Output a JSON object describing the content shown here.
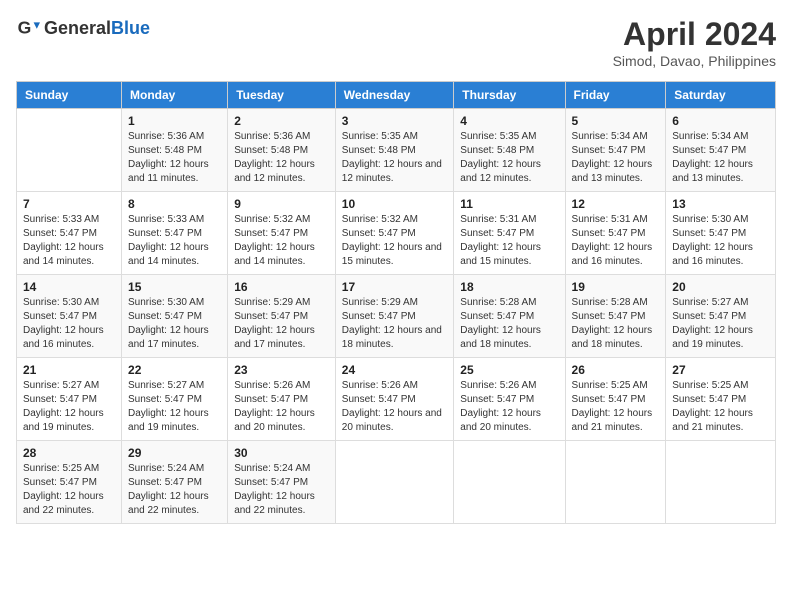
{
  "logo": {
    "text_general": "General",
    "text_blue": "Blue"
  },
  "title": "April 2024",
  "subtitle": "Simod, Davao, Philippines",
  "days_header": [
    "Sunday",
    "Monday",
    "Tuesday",
    "Wednesday",
    "Thursday",
    "Friday",
    "Saturday"
  ],
  "weeks": [
    [
      {
        "num": "",
        "info": ""
      },
      {
        "num": "1",
        "info": "Sunrise: 5:36 AM\nSunset: 5:48 PM\nDaylight: 12 hours and 11 minutes."
      },
      {
        "num": "2",
        "info": "Sunrise: 5:36 AM\nSunset: 5:48 PM\nDaylight: 12 hours and 12 minutes."
      },
      {
        "num": "3",
        "info": "Sunrise: 5:35 AM\nSunset: 5:48 PM\nDaylight: 12 hours and 12 minutes."
      },
      {
        "num": "4",
        "info": "Sunrise: 5:35 AM\nSunset: 5:48 PM\nDaylight: 12 hours and 12 minutes."
      },
      {
        "num": "5",
        "info": "Sunrise: 5:34 AM\nSunset: 5:47 PM\nDaylight: 12 hours and 13 minutes."
      },
      {
        "num": "6",
        "info": "Sunrise: 5:34 AM\nSunset: 5:47 PM\nDaylight: 12 hours and 13 minutes."
      }
    ],
    [
      {
        "num": "7",
        "info": "Sunrise: 5:33 AM\nSunset: 5:47 PM\nDaylight: 12 hours and 14 minutes."
      },
      {
        "num": "8",
        "info": "Sunrise: 5:33 AM\nSunset: 5:47 PM\nDaylight: 12 hours and 14 minutes."
      },
      {
        "num": "9",
        "info": "Sunrise: 5:32 AM\nSunset: 5:47 PM\nDaylight: 12 hours and 14 minutes."
      },
      {
        "num": "10",
        "info": "Sunrise: 5:32 AM\nSunset: 5:47 PM\nDaylight: 12 hours and 15 minutes."
      },
      {
        "num": "11",
        "info": "Sunrise: 5:31 AM\nSunset: 5:47 PM\nDaylight: 12 hours and 15 minutes."
      },
      {
        "num": "12",
        "info": "Sunrise: 5:31 AM\nSunset: 5:47 PM\nDaylight: 12 hours and 16 minutes."
      },
      {
        "num": "13",
        "info": "Sunrise: 5:30 AM\nSunset: 5:47 PM\nDaylight: 12 hours and 16 minutes."
      }
    ],
    [
      {
        "num": "14",
        "info": "Sunrise: 5:30 AM\nSunset: 5:47 PM\nDaylight: 12 hours and 16 minutes."
      },
      {
        "num": "15",
        "info": "Sunrise: 5:30 AM\nSunset: 5:47 PM\nDaylight: 12 hours and 17 minutes."
      },
      {
        "num": "16",
        "info": "Sunrise: 5:29 AM\nSunset: 5:47 PM\nDaylight: 12 hours and 17 minutes."
      },
      {
        "num": "17",
        "info": "Sunrise: 5:29 AM\nSunset: 5:47 PM\nDaylight: 12 hours and 18 minutes."
      },
      {
        "num": "18",
        "info": "Sunrise: 5:28 AM\nSunset: 5:47 PM\nDaylight: 12 hours and 18 minutes."
      },
      {
        "num": "19",
        "info": "Sunrise: 5:28 AM\nSunset: 5:47 PM\nDaylight: 12 hours and 18 minutes."
      },
      {
        "num": "20",
        "info": "Sunrise: 5:27 AM\nSunset: 5:47 PM\nDaylight: 12 hours and 19 minutes."
      }
    ],
    [
      {
        "num": "21",
        "info": "Sunrise: 5:27 AM\nSunset: 5:47 PM\nDaylight: 12 hours and 19 minutes."
      },
      {
        "num": "22",
        "info": "Sunrise: 5:27 AM\nSunset: 5:47 PM\nDaylight: 12 hours and 19 minutes."
      },
      {
        "num": "23",
        "info": "Sunrise: 5:26 AM\nSunset: 5:47 PM\nDaylight: 12 hours and 20 minutes."
      },
      {
        "num": "24",
        "info": "Sunrise: 5:26 AM\nSunset: 5:47 PM\nDaylight: 12 hours and 20 minutes."
      },
      {
        "num": "25",
        "info": "Sunrise: 5:26 AM\nSunset: 5:47 PM\nDaylight: 12 hours and 20 minutes."
      },
      {
        "num": "26",
        "info": "Sunrise: 5:25 AM\nSunset: 5:47 PM\nDaylight: 12 hours and 21 minutes."
      },
      {
        "num": "27",
        "info": "Sunrise: 5:25 AM\nSunset: 5:47 PM\nDaylight: 12 hours and 21 minutes."
      }
    ],
    [
      {
        "num": "28",
        "info": "Sunrise: 5:25 AM\nSunset: 5:47 PM\nDaylight: 12 hours and 22 minutes."
      },
      {
        "num": "29",
        "info": "Sunrise: 5:24 AM\nSunset: 5:47 PM\nDaylight: 12 hours and 22 minutes."
      },
      {
        "num": "30",
        "info": "Sunrise: 5:24 AM\nSunset: 5:47 PM\nDaylight: 12 hours and 22 minutes."
      },
      {
        "num": "",
        "info": ""
      },
      {
        "num": "",
        "info": ""
      },
      {
        "num": "",
        "info": ""
      },
      {
        "num": "",
        "info": ""
      }
    ]
  ]
}
